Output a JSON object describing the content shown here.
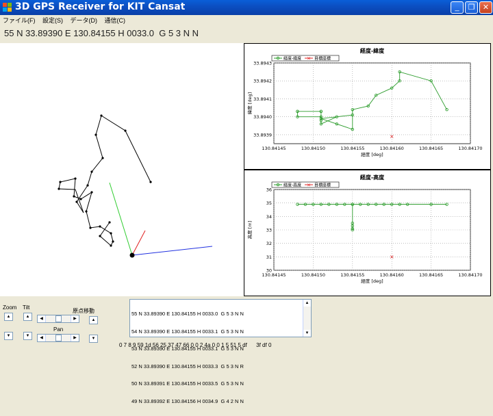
{
  "window": {
    "title": "3D GPS Receiver for KIT Cansat",
    "min": "_",
    "max": "❐",
    "close": "✕"
  },
  "menu": [
    "ファイル(F)",
    "設定(S)",
    "データ(D)",
    "通信(C)"
  ],
  "status_line": "55 N 33.89390 E 130.84155 H 0033.0  G 5 3 N N",
  "charts": [
    {
      "title": "経度-緯度",
      "xlabel": "経度 [deg]",
      "ylabel": "緯度 [deg]",
      "xticks": [
        "130.84145",
        "130.84150",
        "130.84155",
        "130.84160",
        "130.84165",
        "130.84170"
      ],
      "yticks": [
        "33.8939",
        "33.8940",
        "33.8941",
        "33.8942",
        "33.8943"
      ],
      "legend": [
        "経度-緯度",
        "目標座標"
      ]
    },
    {
      "title": "経度-高度",
      "xlabel": "経度 [deg]",
      "ylabel": "高度 [m]",
      "xticks": [
        "130.84145",
        "130.84150",
        "130.84155",
        "130.84160",
        "130.84165",
        "130.84170"
      ],
      "yticks": [
        "30",
        "31",
        "32",
        "33",
        "34",
        "35",
        "36"
      ],
      "legend": [
        "経度-高度",
        "目標座標"
      ]
    }
  ],
  "chart_data": [
    {
      "type": "line",
      "title": "経度-緯度",
      "xlabel": "経度 [deg]",
      "ylabel": "緯度 [deg]",
      "xlim": [
        130.84145,
        130.8417
      ],
      "ylim": [
        33.89385,
        33.8943
      ],
      "grid": true,
      "legend_position": "top-left",
      "series": [
        {
          "name": "経度-緯度",
          "color": "#2a9b2a",
          "x": [
            130.84148,
            130.84151,
            130.84151,
            130.84148,
            130.84148,
            130.84151,
            130.84151,
            130.84151,
            130.84153,
            130.84155,
            130.84151,
            130.84153,
            130.84155,
            130.84155,
            130.84157,
            130.84158,
            130.8416,
            130.84161,
            130.84161,
            130.84165,
            130.84167
          ],
          "y": [
            33.89403,
            33.89403,
            33.894,
            33.894,
            33.89403,
            33.89403,
            33.89398,
            33.89396,
            33.894,
            33.89401,
            33.89399,
            33.89396,
            33.89393,
            33.89404,
            33.89406,
            33.89412,
            33.89416,
            33.8942,
            33.89425,
            33.8942,
            33.89404
          ]
        },
        {
          "name": "目標座標",
          "color": "#e02020",
          "x": [
            130.8416
          ],
          "y": [
            33.89389
          ]
        }
      ]
    },
    {
      "type": "line",
      "title": "経度-高度",
      "xlabel": "経度 [deg]",
      "ylabel": "高度 [m]",
      "xlim": [
        130.84145,
        130.8417
      ],
      "ylim": [
        30,
        36
      ],
      "grid": true,
      "legend_position": "top-left",
      "series": [
        {
          "name": "経度-高度",
          "color": "#2a9b2a",
          "x": [
            130.84148,
            130.84149,
            130.8415,
            130.84151,
            130.84152,
            130.84153,
            130.84154,
            130.84155,
            130.84155,
            130.84155,
            130.84155,
            130.84155,
            130.84155,
            130.84156,
            130.84157,
            130.84158,
            130.84159,
            130.8416,
            130.84161,
            130.84162,
            130.84165,
            130.84167
          ],
          "y": [
            34.9,
            34.9,
            34.9,
            34.9,
            34.9,
            34.9,
            34.9,
            34.9,
            33.5,
            33.3,
            33.1,
            33.0,
            34.9,
            34.9,
            34.9,
            34.9,
            34.9,
            34.9,
            34.9,
            34.9,
            34.9,
            34.9
          ]
        },
        {
          "name": "目標座標",
          "color": "#e02020",
          "x": [
            130.8416
          ],
          "y": [
            31.0
          ]
        }
      ]
    }
  ],
  "controls": {
    "zoom": "Zoom",
    "tilt": "Tilt",
    "origin": "原点移動",
    "pan": "Pan"
  },
  "log": [
    "55 N 33.89390 E 130.84155 H 0033.0  G 5 3 N N",
    "54 N 33.89390 E 130.84155 H 0033.1  G 5 3 N N",
    "53 N 33.89390 E 130.84155 H 0033.1  G 5 3 N N",
    "52 N 33.89390 E 130.84155 H 0033.3  G 5 3 N R",
    "50 N 33.89391 E 130.84155 H 0033.5  G 5 3 N N",
    "49 N 33.89392 E 130.84156 H 0034.9  G 4 2 N N"
  ],
  "hex_line": "0 7 8 9 59 1d 56 25 37 47 66 0 0 2 4a 0 0 1 5 51 5 df      3f df 0"
}
